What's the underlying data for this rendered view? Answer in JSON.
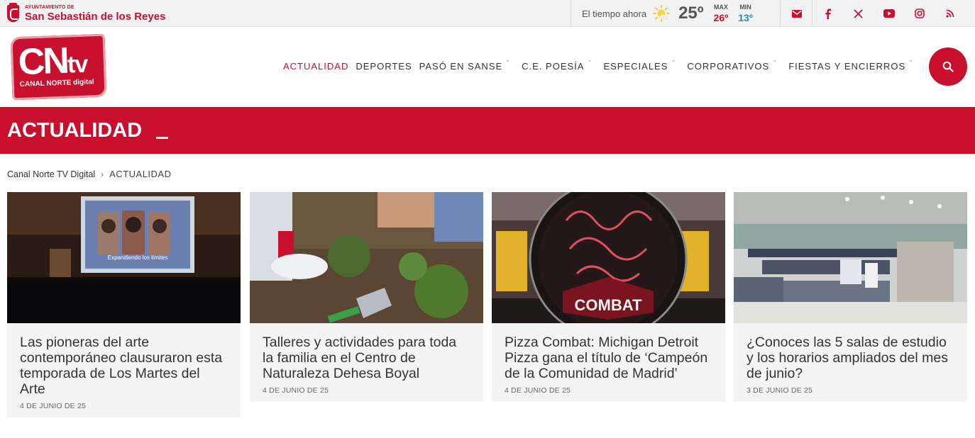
{
  "topbar": {
    "ayto_small": "AYUNTAMIENTO DE",
    "ayto_name": "San Sebastián de los Reyes",
    "weather_label": "El tiempo ahora",
    "weather_icon": "sun-cloud-icon",
    "temp_now": "25º",
    "max_label": "MAX",
    "max_value": "26º",
    "min_label": "MIN",
    "min_value": "13º",
    "social": [
      "mail-icon",
      "facebook-icon",
      "x-icon",
      "youtube-icon",
      "instagram-icon",
      "rss-icon"
    ]
  },
  "header": {
    "logo_main": "CN",
    "logo_tv": "tv",
    "logo_sub": "CANAL NORTE digital",
    "nav": [
      {
        "label": "ACTUALIDAD",
        "active": true,
        "dropdown": false
      },
      {
        "label": "DEPORTES",
        "active": false,
        "dropdown": false
      },
      {
        "label": "PASÓ EN SANSE",
        "active": false,
        "dropdown": true
      },
      {
        "label": "C.E. POESÍA",
        "active": false,
        "dropdown": true
      },
      {
        "label": "ESPECIALES",
        "active": false,
        "dropdown": true
      },
      {
        "label": "CORPORATIVOS",
        "active": false,
        "dropdown": true
      },
      {
        "label": "FIESTAS Y ENCIERROS",
        "active": false,
        "dropdown": true
      }
    ],
    "search_icon": "search-icon"
  },
  "banner": {
    "title": "ACTUALIDAD"
  },
  "breadcrumb": {
    "home": "Canal Norte TV Digital",
    "current": "ACTUALIDAD"
  },
  "cards": [
    {
      "title": "Las pioneras del arte contemporáneo clausuraron esta temporada de Los Martes del Arte",
      "date": "4 DE JUNIO DE 25",
      "image_caption": "Expandiendo los límites"
    },
    {
      "title": "Talleres y actividades para toda la familia en el Centro de Naturaleza Dehesa Boyal",
      "date": "4 DE JUNIO DE 25"
    },
    {
      "title": "Pizza Combat: Michigan Detroit Pizza gana el título de ‘Campeón de la Comunidad de Madrid’",
      "date": "4 DE JUNIO DE 25",
      "image_caption": "COMBAT"
    },
    {
      "title": "¿Conoces las 5 salas de estudio y los horarios ampliados del mes de junio?",
      "date": "3 DE JUNIO DE 25"
    }
  ],
  "colors": {
    "brand": "#c8102e",
    "min_temp": "#1f8fb5"
  }
}
